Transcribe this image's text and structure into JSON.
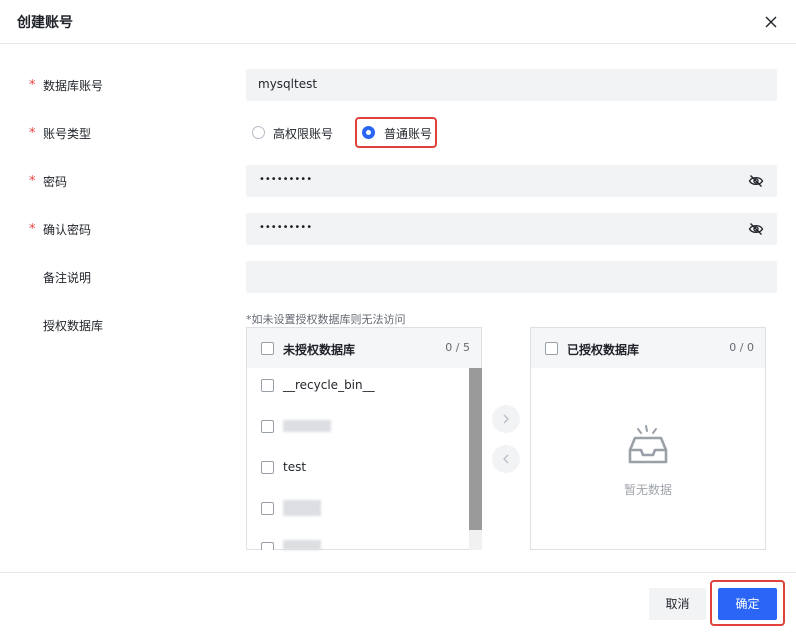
{
  "dialog": {
    "title": "创建账号"
  },
  "form": {
    "db_account": {
      "label": "数据库账号",
      "value": "mysqltest"
    },
    "account_type": {
      "label": "账号类型",
      "options": [
        "高权限账号",
        "普通账号"
      ],
      "selected": "普通账号"
    },
    "password": {
      "label": "密码",
      "value": "•••••••••"
    },
    "confirm_password": {
      "label": "确认密码",
      "value": "•••••••••"
    },
    "remark": {
      "label": "备注说明",
      "value": ""
    },
    "authorized_db": {
      "label": "授权数据库",
      "hint": "*如未设置授权数据库则无法访问"
    }
  },
  "transfer": {
    "left": {
      "title": "未授权数据库",
      "count": "0 / 5",
      "items": [
        "__recycle_bin__",
        "",
        "test",
        "",
        ""
      ]
    },
    "right": {
      "title": "已授权数据库",
      "count": "0 / 0",
      "empty_text": "暂无数据"
    }
  },
  "footer": {
    "cancel": "取消",
    "confirm": "确定"
  },
  "colors": {
    "primary": "#2b65f5",
    "required": "#e54545",
    "highlight": "#e0413b"
  },
  "icons": {
    "close": "close-icon",
    "eye": "eye-off-icon",
    "arrow_right": "chevron-right-icon",
    "arrow_left": "chevron-left-icon",
    "empty": "empty-inbox-icon"
  }
}
